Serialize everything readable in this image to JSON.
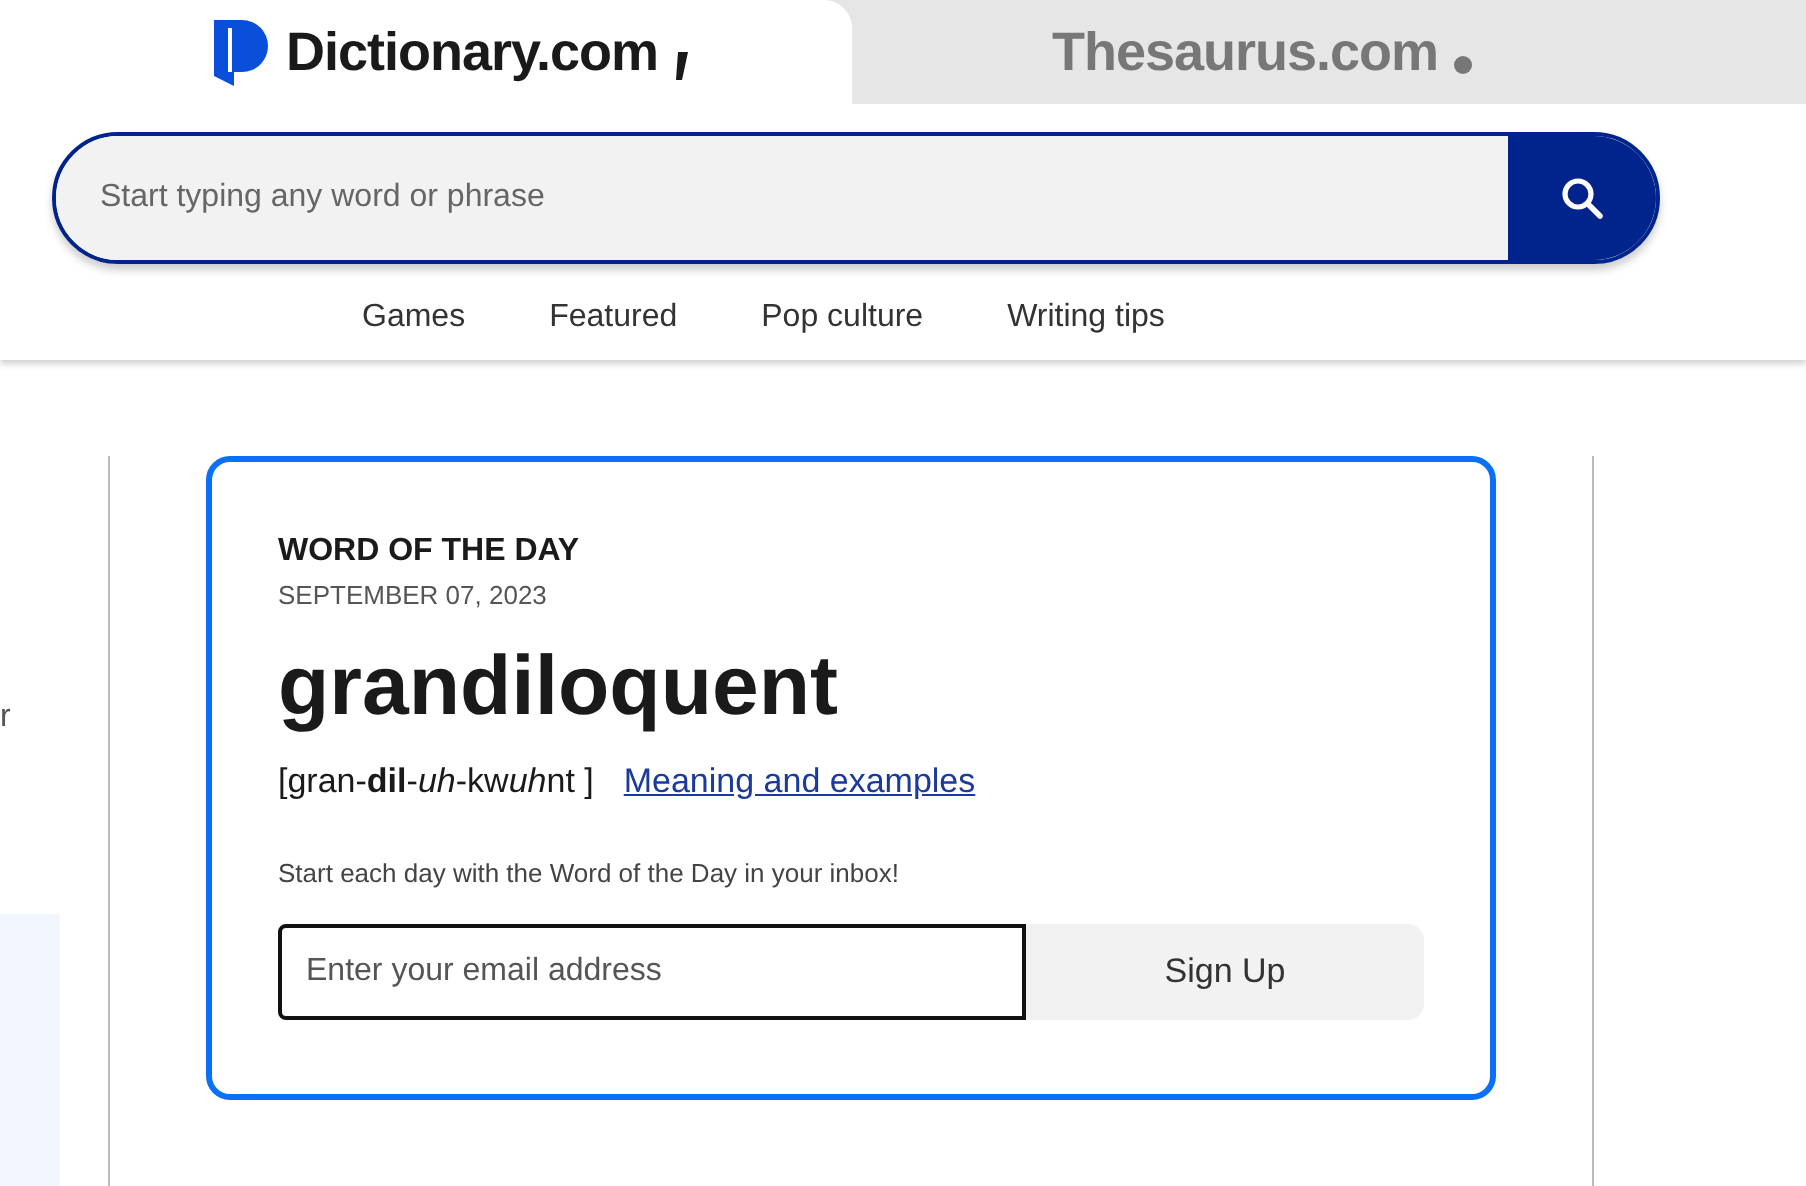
{
  "tabs": [
    {
      "label": "Dictionary.com",
      "selected": true,
      "kind": "dictionary"
    },
    {
      "label": "Thesaurus.com",
      "selected": false,
      "kind": "thesaurus"
    }
  ],
  "search": {
    "placeholder": "Start typing any word or phrase"
  },
  "nav": [
    "Games",
    "Featured",
    "Pop culture",
    "Writing tips"
  ],
  "side_text": "r",
  "word_of_the_day": {
    "heading": "WORD OF THE DAY",
    "date": "SEPTEMBER 07, 2023",
    "word": "grandiloquent",
    "pronunciation": [
      {
        "text": "[gran-",
        "kind": "plain"
      },
      {
        "text": "dil",
        "kind": "stressed"
      },
      {
        "text": "-",
        "kind": "plain"
      },
      {
        "text": "uh",
        "kind": "reduced"
      },
      {
        "text": "-kw",
        "kind": "plain"
      },
      {
        "text": "uh",
        "kind": "reduced"
      },
      {
        "text": "nt ]",
        "kind": "plain"
      }
    ],
    "link": "Meaning and examples",
    "prompt": "Start each day with the Word of the Day in your inbox!",
    "email_placeholder": "Enter your email address",
    "button": "Sign Up"
  }
}
